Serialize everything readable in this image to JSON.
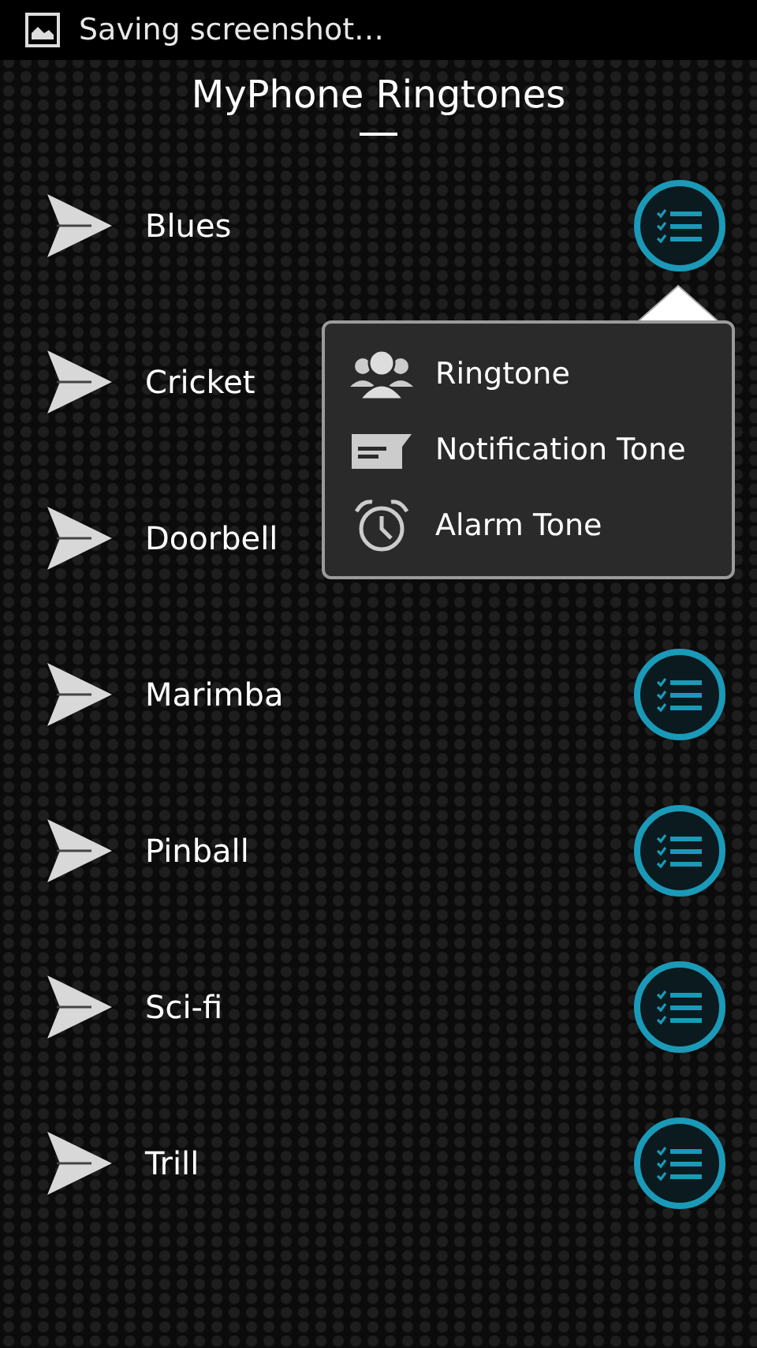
{
  "status_bar": {
    "notification": "Saving screenshot…"
  },
  "title": "MyPhone Ringtones",
  "ringtones": [
    {
      "name": "Blues",
      "menu_button": true
    },
    {
      "name": "Cricket",
      "menu_button": false
    },
    {
      "name": "Doorbell",
      "menu_button": false
    },
    {
      "name": "Marimba",
      "menu_button": true
    },
    {
      "name": "Pinball",
      "menu_button": true
    },
    {
      "name": "Sci-fi",
      "menu_button": true
    },
    {
      "name": "Trill",
      "menu_button": true
    }
  ],
  "popup_menu": {
    "items": [
      {
        "kind": "ringtone",
        "label": "Ringtone"
      },
      {
        "kind": "notification",
        "label": "Notification Tone"
      },
      {
        "kind": "alarm",
        "label": "Alarm Tone"
      }
    ]
  }
}
